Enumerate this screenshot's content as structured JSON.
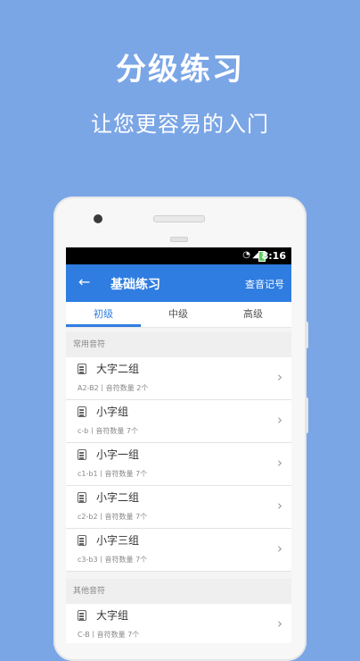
{
  "promo": {
    "title": "分级练习",
    "subtitle": "让您更容易的入门"
  },
  "statusbar": {
    "time": "8:16"
  },
  "appbar": {
    "back_icon": "arrow-left-icon",
    "title": "基础练习",
    "action": "查音记号"
  },
  "tabs": [
    {
      "label": "初级",
      "active": true
    },
    {
      "label": "中级",
      "active": false
    },
    {
      "label": "高级",
      "active": false
    }
  ],
  "sections": [
    {
      "title": "常用音符",
      "items": [
        {
          "name": "大字二组",
          "meta": "A2-B2丨音符数量 2个"
        },
        {
          "name": "小字组",
          "meta": "c-b丨音符数量 7个"
        },
        {
          "name": "小字一组",
          "meta": "c1-b1丨音符数量 7个"
        },
        {
          "name": "小字二组",
          "meta": "c2-b2丨音符数量 7个"
        },
        {
          "name": "小字三组",
          "meta": "c3-b3丨音符数量 7个"
        }
      ]
    },
    {
      "title": "其他音符",
      "items": [
        {
          "name": "大字组",
          "meta": "C-B丨音符数量 7个"
        }
      ]
    }
  ],
  "colors": {
    "background": "#7ba6e6",
    "accent": "#2f7de1"
  }
}
